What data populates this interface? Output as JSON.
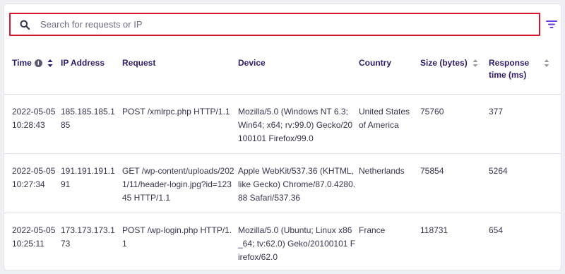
{
  "search": {
    "placeholder": "Search for requests or IP",
    "value": ""
  },
  "icons": {
    "search": "search-icon",
    "filter": "filter-icon",
    "info": "info-icon",
    "sort": "sort-icon"
  },
  "colors": {
    "accent": "#673de6",
    "highlight_border": "#d9142c",
    "text_primary": "#2f1c6a"
  },
  "table": {
    "headers": {
      "time": "Time",
      "ip": "IP Address",
      "request": "Request",
      "device": "Device",
      "country": "Country",
      "size": "Size (bytes)",
      "response": "Response time (ms)"
    },
    "rows": [
      {
        "date": "2022-05-05",
        "time": "10:28:43",
        "ip": "185.185.185.185",
        "request": "POST /xmlrpc.php HTTP/1.1",
        "device": "Mozilla/5.0 (Windows NT 6.3; Win64; x64; rv:99.0) Gecko/20100101 Firefox/99.0",
        "country": "United States of America",
        "size": "75760",
        "response": "377"
      },
      {
        "date": "2022-05-05",
        "time": "10:27:34",
        "ip": "191.191.191.191",
        "request": "GET /wp-content/uploads/2021/11/header-login.jpg?id=12345 HTTP/1.1",
        "device": "Apple WebKit/537.36 (KHTML, like Gecko) Chrome/87.0.4280.88 Safari/537.36",
        "country": "Netherlands",
        "size": "75854",
        "response": "5264"
      },
      {
        "date": "2022-05-05",
        "time": "10:25:11",
        "ip": "173.173.173.173",
        "request": "POST /wp-login.php HTTP/1.1",
        "device": "Mozilla/5.0 (Ubuntu; Linux x86_64; tv:62.0) Geko/20100101 Firefox/62.0",
        "country": "France",
        "size": "118731",
        "response": "654"
      }
    ]
  }
}
